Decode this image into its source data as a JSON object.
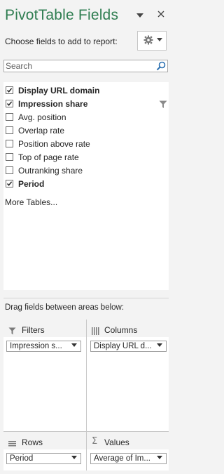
{
  "title": "PivotTable Fields",
  "header": {
    "choose_label": "Choose fields to add to report:"
  },
  "search": {
    "placeholder": "Search"
  },
  "fields": [
    {
      "label": "Display URL domain",
      "checked": true,
      "bold": true
    },
    {
      "label": "Impression share",
      "checked": true,
      "bold": true,
      "filtered": true
    },
    {
      "label": "Avg. position",
      "checked": false,
      "bold": false
    },
    {
      "label": "Overlap rate",
      "checked": false,
      "bold": false
    },
    {
      "label": "Position above rate",
      "checked": false,
      "bold": false
    },
    {
      "label": "Top of page rate",
      "checked": false,
      "bold": false
    },
    {
      "label": "Outranking share",
      "checked": false,
      "bold": false
    },
    {
      "label": "Period",
      "checked": true,
      "bold": true
    }
  ],
  "more_tables": "More Tables...",
  "drag_label": "Drag fields between areas below:",
  "areas": {
    "filters": {
      "title": "Filters",
      "item": "Impression s..."
    },
    "columns": {
      "title": "Columns",
      "item": "Display URL d..."
    },
    "rows": {
      "title": "Rows",
      "item": "Period"
    },
    "values": {
      "title": "Values",
      "item": "Average of Im..."
    }
  },
  "colors": {
    "title": "#2e7d50",
    "panel_bg": "#f3f3f3"
  }
}
